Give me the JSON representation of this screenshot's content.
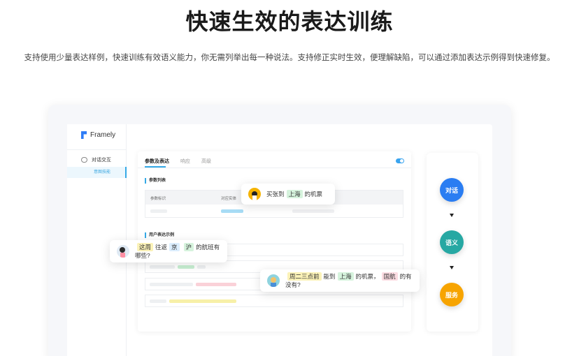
{
  "hero": {
    "title": "快速生效的表达训练",
    "description": "支持使用少量表达样例，快速训练有效语义能力，你无需列举出每一种说法。支持修正实时生效，便理解缺陷，可以通过添加表达示例得到快速修复。"
  },
  "app": {
    "brand": "Framely",
    "sidebar": {
      "group_label": "对话交互",
      "active_item": "意图技能"
    },
    "tabs": [
      {
        "label": "参数及表达",
        "active": true
      },
      {
        "label": "响应",
        "active": false
      },
      {
        "label": "高级",
        "active": false
      }
    ],
    "toggle_on": true,
    "params_section": {
      "title": "参数列表",
      "columns": [
        "参数标识",
        "对应实体"
      ]
    },
    "examples_section": {
      "title": "用户表达示例"
    }
  },
  "bubbles": {
    "top": {
      "avatar_icon": "user-avatar-icon",
      "segments": [
        {
          "text": "买张到",
          "tag": null
        },
        {
          "text": "上海",
          "tag": "green"
        },
        {
          "text": "的机票",
          "tag": null
        }
      ]
    },
    "left": {
      "avatar_icon": "user-avatar-icon",
      "segments": [
        {
          "text": "这周",
          "tag": "yellow"
        },
        {
          "text": "往返",
          "tag": null
        },
        {
          "text": "京",
          "tag": "blue"
        },
        {
          "text": "沪",
          "tag": "green"
        },
        {
          "text": "的航班有哪些?",
          "tag": null
        }
      ]
    },
    "right": {
      "avatar_icon": "user-avatar-icon",
      "segments": [
        {
          "text": "周二三点前",
          "tag": "yellow"
        },
        {
          "text": "能到",
          "tag": null
        },
        {
          "text": "上海",
          "tag": "green"
        },
        {
          "text": "的机票，",
          "tag": null
        },
        {
          "text": "国航",
          "tag": "pink"
        },
        {
          "text": "的有没有?",
          "tag": null
        }
      ]
    }
  },
  "flow": {
    "steps": [
      {
        "label": "对话",
        "color": "#2a7df2"
      },
      {
        "label": "语义",
        "color": "#27a8a3"
      },
      {
        "label": "服务",
        "color": "#f7a400"
      }
    ]
  },
  "colors": {
    "accent": "#35a9e6",
    "tag_yellow": "#fbf2b8",
    "tag_blue": "#dceefe",
    "tag_green": "#d6f3dd",
    "tag_pink": "#fbdce2"
  }
}
